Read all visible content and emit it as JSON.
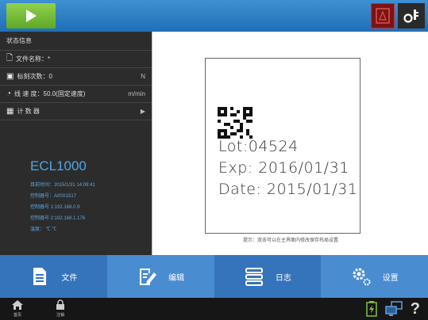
{
  "status": {
    "header": "状态信息",
    "rows": [
      {
        "icon": "file-icon",
        "label": "文件名称：*",
        "right": ""
      },
      {
        "icon": "counter-icon",
        "label": "标刻次数：0",
        "right": "N"
      },
      {
        "icon": "speed-icon",
        "label": "线 速 度：50.0(固定速度)",
        "right": "m/min"
      },
      {
        "icon": "calculator-icon",
        "label": "计 数 器",
        "right": "▶"
      }
    ]
  },
  "device": {
    "model": "ECL1000",
    "lines": [
      "目前时间：2015/1/31 14:09:41",
      "控制器号：A00X1517",
      "控制器号 1:192.168.0.9",
      "控制器号 2:192.168.1.176",
      "温度：  ℃  ℃"
    ]
  },
  "preview": {
    "lines": [
      "Lot:04524",
      "Exp: 2016/01/31",
      "Date: 2015/01/31"
    ],
    "hint": "提示：双击可以在主界面内修改保存布局设置"
  },
  "nav": [
    {
      "label": "文件"
    },
    {
      "label": "编辑"
    },
    {
      "label": "日志"
    },
    {
      "label": "设置"
    }
  ],
  "statusbar": {
    "home_label": "首页",
    "lock_label": "注销"
  }
}
